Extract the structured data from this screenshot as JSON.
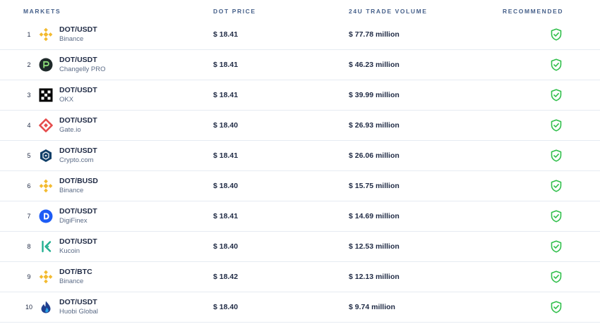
{
  "header": {
    "markets": "MARKETS",
    "price": "DOT PRICE",
    "volume": "24U TRADE VOLUME",
    "recommended": "RECOMMENDED"
  },
  "colors": {
    "recommended_green": "#2fbf4a",
    "binance": "#f3ba2f",
    "changelly": "#1f2a2a",
    "okx": "#000000",
    "gate": "#e54b4b",
    "crypto_com": "#103f68",
    "digifinex": "#1d5cf5",
    "kucoin": "#23af91",
    "huobi": "#1f3f8f"
  },
  "rows": [
    {
      "rank": "1",
      "pair": "DOT/USDT",
      "exchange": "Binance",
      "price": "$ 18.41",
      "volume": "$ 77.78 million",
      "logo": "binance-icon"
    },
    {
      "rank": "2",
      "pair": "DOT/USDT",
      "exchange": "Changelly PRO",
      "price": "$ 18.41",
      "volume": "$ 46.23 million",
      "logo": "changelly-pro-icon"
    },
    {
      "rank": "3",
      "pair": "DOT/USDT",
      "exchange": "OKX",
      "price": "$ 18.41",
      "volume": "$ 39.99 million",
      "logo": "okx-icon"
    },
    {
      "rank": "4",
      "pair": "DOT/USDT",
      "exchange": "Gate.io",
      "price": "$ 18.40",
      "volume": "$ 26.93 million",
      "logo": "gate-io-icon"
    },
    {
      "rank": "5",
      "pair": "DOT/USDT",
      "exchange": "Crypto.com",
      "price": "$ 18.41",
      "volume": "$ 26.06 million",
      "logo": "crypto-com-icon"
    },
    {
      "rank": "6",
      "pair": "DOT/BUSD",
      "exchange": "Binance",
      "price": "$ 18.40",
      "volume": "$ 15.75 million",
      "logo": "binance-icon"
    },
    {
      "rank": "7",
      "pair": "DOT/USDT",
      "exchange": "DigiFinex",
      "price": "$ 18.41",
      "volume": "$ 14.69 million",
      "logo": "digifinex-icon"
    },
    {
      "rank": "8",
      "pair": "DOT/USDT",
      "exchange": "Kucoin",
      "price": "$ 18.40",
      "volume": "$ 12.53 million",
      "logo": "kucoin-icon"
    },
    {
      "rank": "9",
      "pair": "DOT/BTC",
      "exchange": "Binance",
      "price": "$ 18.42",
      "volume": "$ 12.13 million",
      "logo": "binance-icon"
    },
    {
      "rank": "10",
      "pair": "DOT/USDT",
      "exchange": "Huobi Global",
      "price": "$ 18.40",
      "volume": "$ 9.74 million",
      "logo": "huobi-global-icon"
    }
  ]
}
